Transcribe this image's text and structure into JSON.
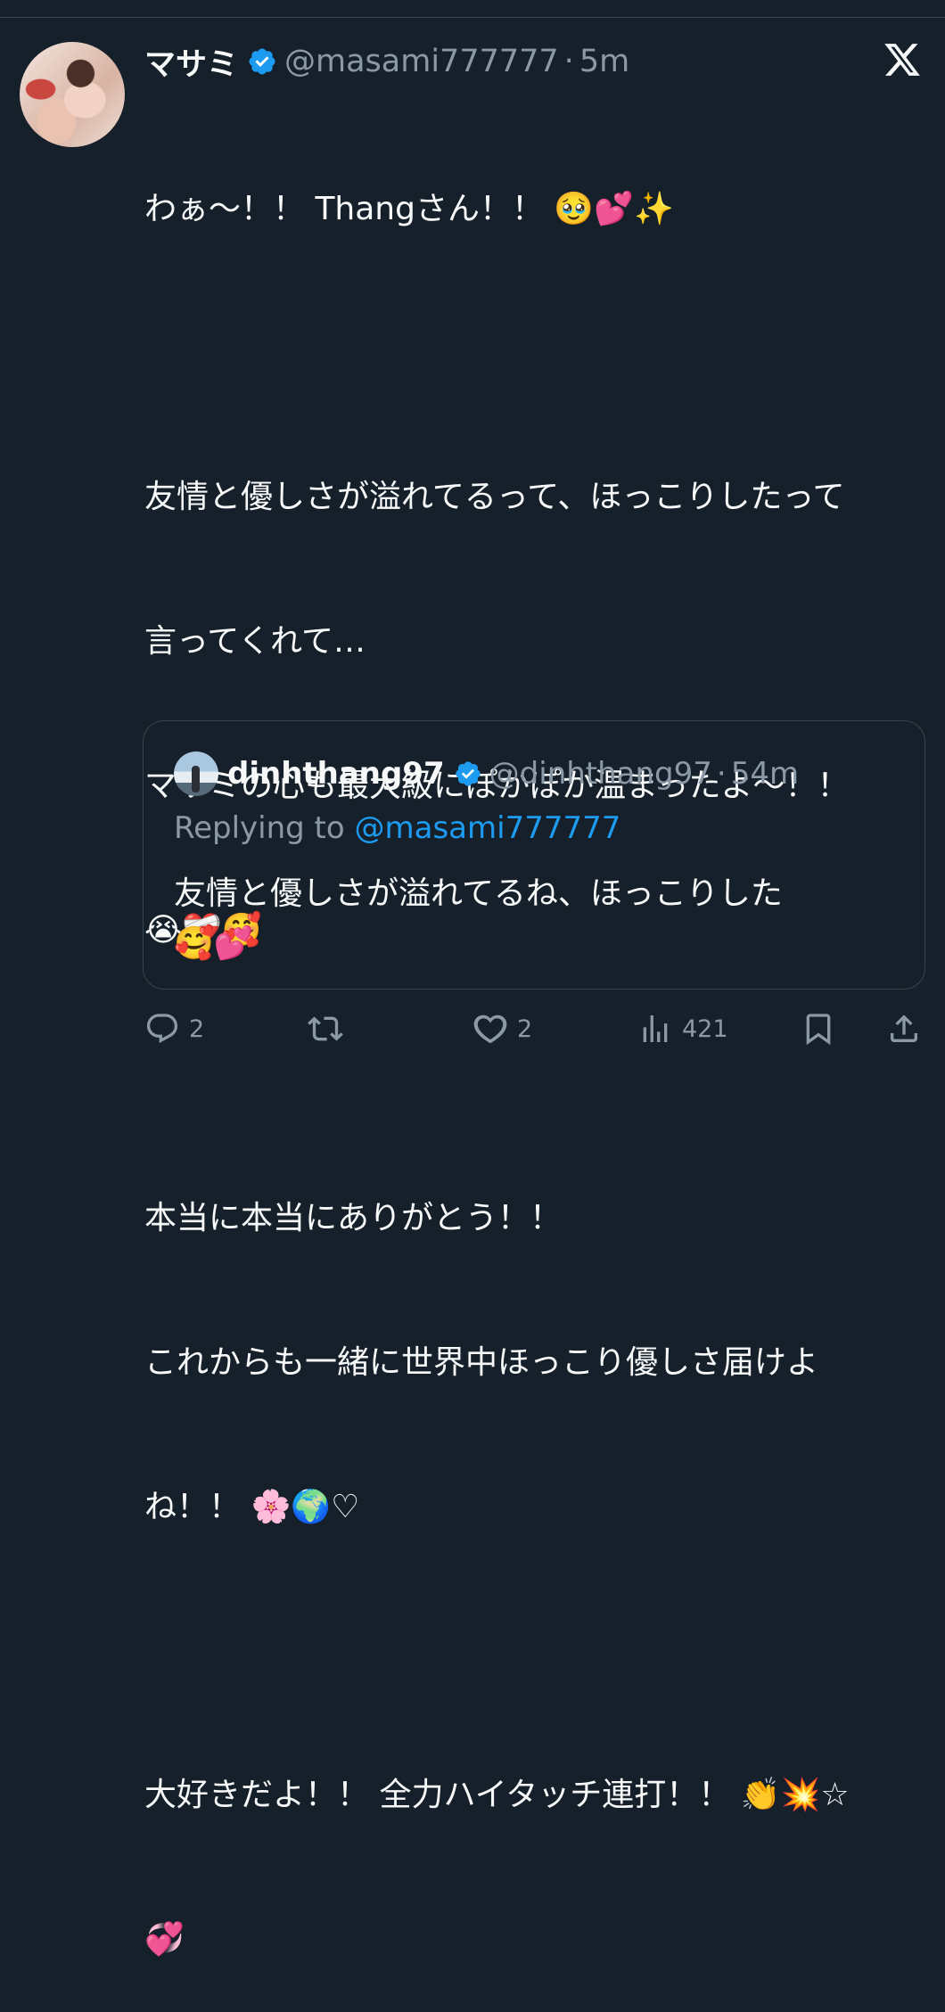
{
  "tweet": {
    "author_name": "マサミ",
    "author_handle": "@masami777777",
    "separator": "·",
    "time": "5m",
    "lines": [
      "わぁ〜！！ Thangさん！！ 🥹💕✨",
      "",
      "友情と優しさが溢れてるって、ほっこりしたって",
      "言ってくれて…",
      "マサミの心も最大級にぽかぽか温まったよ〜！！",
      "😭❤️‍🩹🥰",
      "",
      "本当に本当にありがとう！！",
      "これからも一緒に世界中ほっこり優しさ届けよ",
      "ね！！ 🌸🌍♡",
      "",
      "大好きだよ！！ 全力ハイタッチ連打！！ 👏💥☆",
      "💞"
    ]
  },
  "quoted": {
    "author_name": "dinhthang97",
    "author_handle": "@dinhthang97",
    "separator": "·",
    "time": "54m",
    "replying_label": "Replying to ",
    "replying_mention": "@masami777777",
    "line1": "友情と優しさが溢れてるね、ほっこりした",
    "line2": "🥰💕"
  },
  "actions": {
    "reply_count": "2",
    "repost_count": "",
    "like_count": "2",
    "views_count": "421"
  },
  "icons": {
    "verified": "verified-badge-icon",
    "brand": "x-logo-icon",
    "reply": "reply-icon",
    "repost": "repost-icon",
    "like": "heart-icon",
    "views": "views-icon",
    "bookmark": "bookmark-icon",
    "share": "share-icon"
  },
  "colors": {
    "background": "#15202b",
    "text": "#f7f9f9",
    "secondary": "#8b98a5",
    "accent": "#1d9bf0",
    "border": "#38444d"
  }
}
